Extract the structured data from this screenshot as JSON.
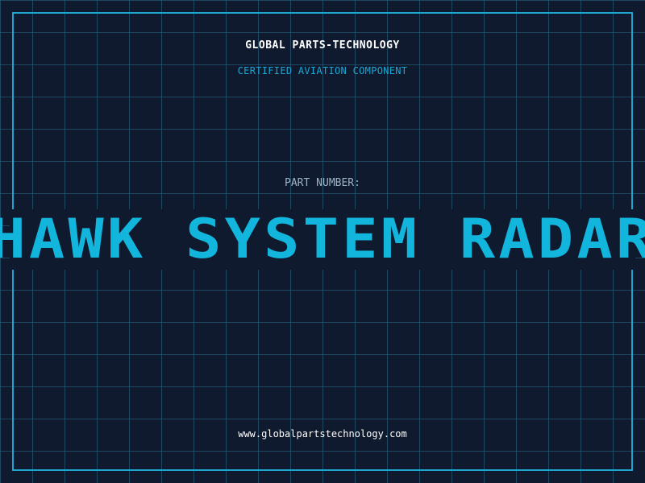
{
  "header": {
    "brand": "GLOBAL PARTS-TECHNOLOGY",
    "tagline": "CERTIFIED AVIATION COMPONENT"
  },
  "part": {
    "label": "PART NUMBER:",
    "name": "HAWK SYSTEM RADAR"
  },
  "footer": {
    "website": "www.globalpartstechnology.com"
  },
  "colors": {
    "background": "#0f1a2e",
    "grid": "#2a6e8c",
    "frame": "#1fa6cf",
    "accent": "#12b5dc",
    "brand_text": "#ffffff",
    "label_text": "#9fb3c8"
  }
}
